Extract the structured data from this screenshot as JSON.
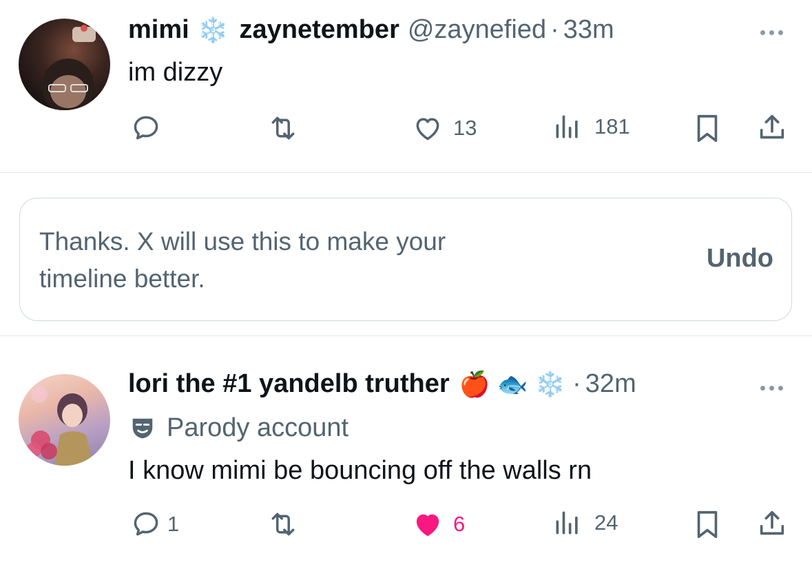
{
  "post1": {
    "display_name": "mimi",
    "display_name_emoji": "❄️",
    "secondary_name": "zaynetember",
    "handle": "@zaynefied",
    "separator": "·",
    "time": "33m",
    "text": "im dizzy",
    "actions": {
      "replies": "",
      "reposts": "",
      "likes": "13",
      "views": "181"
    }
  },
  "notice": {
    "line1": "Thanks. X will use this to make your",
    "line2": "timeline better.",
    "undo_label": "Undo"
  },
  "post2": {
    "display_name": "lori the #1 yandelb truther",
    "name_emojis": [
      "🍎",
      "🐟",
      "❄️"
    ],
    "separator": "·",
    "time": "32m",
    "badge_label": "Parody account",
    "text": "I know mimi be bouncing off the walls rn",
    "actions": {
      "replies": "1",
      "reposts": "",
      "likes": "6",
      "views": "24",
      "liked": true
    }
  },
  "colors": {
    "text_primary": "#0f1419",
    "text_secondary": "#536471",
    "like_active": "#f91880",
    "border": "#cfd9de"
  },
  "icons": [
    "reply-icon",
    "repost-icon",
    "like-icon",
    "views-icon",
    "bookmark-icon",
    "share-icon",
    "more-icon",
    "parody-mask-icon"
  ]
}
